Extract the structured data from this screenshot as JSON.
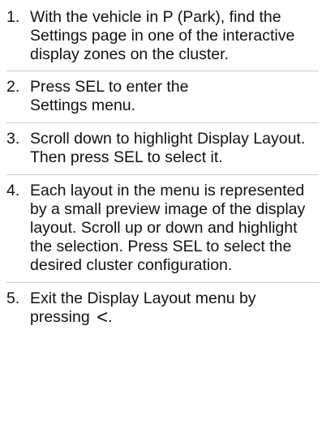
{
  "steps": [
    {
      "number": "1.",
      "text": "With the vehicle in P (Park), find the Settings page in one of the interactive display zones on the cluster."
    },
    {
      "number": "2.",
      "text": "Press SEL to enter the Settings menu."
    },
    {
      "number": "3.",
      "text": "Scroll down to highlight Display Layout. Then press SEL to select it."
    },
    {
      "number": "4.",
      "text": "Each layout in the menu is represented by a small preview image of the display layout. Scroll up or down and highlight the selection. Press SEL to select the desired cluster configuration."
    },
    {
      "number": "5.",
      "text": "Exit the Display Layout menu by pressing",
      "icon": "back-chevron-icon",
      "trailing": "."
    }
  ]
}
